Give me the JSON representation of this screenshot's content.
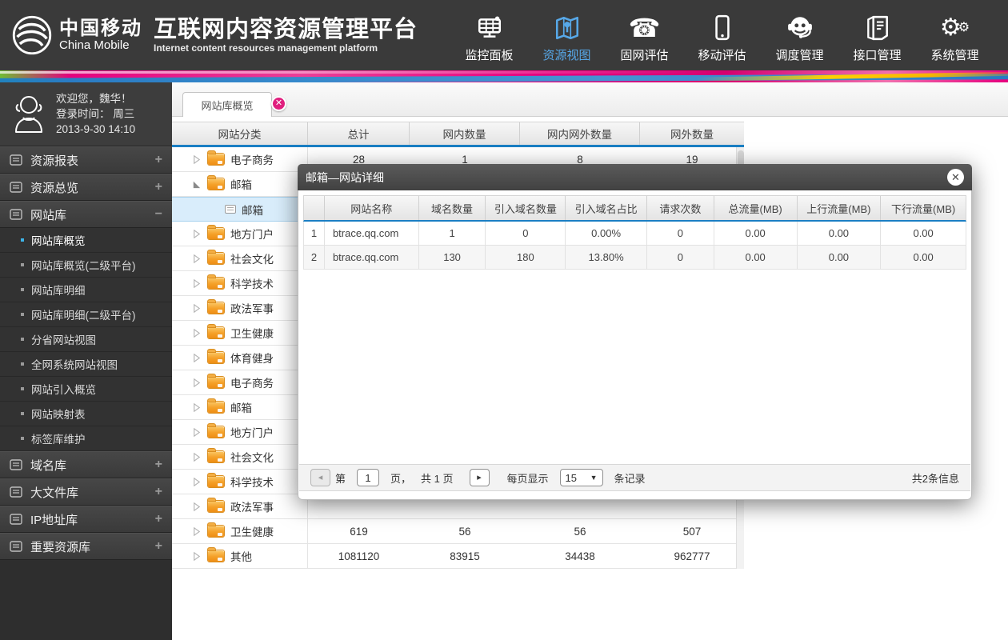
{
  "header": {
    "logo_cn": "中国移动",
    "logo_en": "China Mobile",
    "title": "互联网内容资源管理平台",
    "subtitle": "Internet content resources management platform",
    "nav": [
      {
        "label": "监控面板",
        "icon": "dashboard-icon",
        "active": false
      },
      {
        "label": "资源视图",
        "icon": "map-icon",
        "active": true
      },
      {
        "label": "固网评估",
        "icon": "telephone-icon",
        "active": false
      },
      {
        "label": "移动评估",
        "icon": "mobile-icon",
        "active": false
      },
      {
        "label": "调度管理",
        "icon": "headset-icon",
        "active": false
      },
      {
        "label": "接口管理",
        "icon": "document-icon",
        "active": false
      },
      {
        "label": "系统管理",
        "icon": "gears-icon",
        "active": false
      }
    ]
  },
  "sidebar": {
    "user": {
      "welcome": "欢迎您，魏华！",
      "login_line": "登录时间：  周三",
      "login_datetime": "2013-9-30   14:10"
    },
    "groups_top": [
      {
        "label": "资源报表",
        "expander": "+",
        "expanded": false
      },
      {
        "label": "资源总览",
        "expander": "+",
        "expanded": false
      },
      {
        "label": "网站库",
        "expander": "−",
        "expanded": true
      }
    ],
    "submenu": [
      {
        "label": "网站库概览",
        "active": true
      },
      {
        "label": "网站库概览(二级平台)",
        "active": false
      },
      {
        "label": "网站库明细",
        "active": false
      },
      {
        "label": "网站库明细(二级平台)",
        "active": false
      },
      {
        "label": "分省网站视图",
        "active": false
      },
      {
        "label": "全网系统网站视图",
        "active": false
      },
      {
        "label": "网站引入概览",
        "active": false
      },
      {
        "label": "网站映射表",
        "active": false
      },
      {
        "label": "标签库维护",
        "active": false
      }
    ],
    "groups_bottom": [
      {
        "label": "域名库",
        "expander": "+",
        "expanded": false
      },
      {
        "label": "大文件库",
        "expander": "+",
        "expanded": false
      },
      {
        "label": "IP地址库",
        "expander": "+",
        "expanded": false
      },
      {
        "label": "重要资源库",
        "expander": "+",
        "expanded": false
      }
    ]
  },
  "main": {
    "tab": {
      "label": "网站库概览",
      "close": "✕"
    },
    "table": {
      "headers": [
        "网站分类",
        "总计",
        "网内数量",
        "网内网外数量",
        "网外数量"
      ],
      "rows": [
        {
          "label": "电子商务",
          "node": "collapsed",
          "selected": false,
          "values": [
            "28",
            "1",
            "8",
            "19"
          ]
        },
        {
          "label": "邮箱",
          "node": "expanded",
          "selected": false,
          "values": [
            "",
            "",
            "",
            ""
          ]
        },
        {
          "label": "邮箱",
          "node": "leaf",
          "selected": true,
          "values": [
            "",
            "",
            "",
            ""
          ]
        },
        {
          "label": "地方门户",
          "node": "collapsed",
          "selected": false,
          "values": [
            "",
            "",
            "",
            ""
          ]
        },
        {
          "label": "社会文化",
          "node": "collapsed",
          "selected": false,
          "values": [
            "",
            "",
            "",
            ""
          ]
        },
        {
          "label": "科学技术",
          "node": "collapsed",
          "selected": false,
          "values": [
            "",
            "",
            "",
            ""
          ]
        },
        {
          "label": "政法军事",
          "node": "collapsed",
          "selected": false,
          "values": [
            "",
            "",
            "",
            ""
          ]
        },
        {
          "label": "卫生健康",
          "node": "collapsed",
          "selected": false,
          "values": [
            "",
            "",
            "",
            ""
          ]
        },
        {
          "label": "体育健身",
          "node": "collapsed",
          "selected": false,
          "values": [
            "",
            "",
            "",
            ""
          ]
        },
        {
          "label": "电子商务",
          "node": "collapsed",
          "selected": false,
          "values": [
            "",
            "",
            "",
            ""
          ]
        },
        {
          "label": "邮箱",
          "node": "collapsed",
          "selected": false,
          "values": [
            "",
            "",
            "",
            ""
          ]
        },
        {
          "label": "地方门户",
          "node": "collapsed",
          "selected": false,
          "values": [
            "",
            "",
            "",
            ""
          ]
        },
        {
          "label": "社会文化",
          "node": "collapsed",
          "selected": false,
          "values": [
            "",
            "",
            "",
            ""
          ]
        },
        {
          "label": "科学技术",
          "node": "collapsed",
          "selected": false,
          "values": [
            "",
            "",
            "",
            ""
          ]
        },
        {
          "label": "政法军事",
          "node": "collapsed",
          "selected": false,
          "values": [
            "",
            "",
            "",
            ""
          ]
        },
        {
          "label": "卫生健康",
          "node": "collapsed",
          "selected": false,
          "values": [
            "619",
            "56",
            "56",
            "507"
          ]
        },
        {
          "label": "其他",
          "node": "collapsed",
          "selected": false,
          "values": [
            "1081120",
            "83915",
            "34438",
            "962777"
          ]
        }
      ]
    }
  },
  "modal": {
    "title": "邮箱—网站详细",
    "close": "✕",
    "table": {
      "headers": [
        "",
        "网站名称",
        "域名数量",
        "引入域名数量",
        "引入域名占比",
        "请求次数",
        "总流量(MB)",
        "上行流量(MB)",
        "下行流量(MB)"
      ],
      "rows": [
        [
          "1",
          "btrace.qq.com",
          "1",
          "0",
          "0.00%",
          "0",
          "0.00",
          "0.00",
          "0.00"
        ],
        [
          "2",
          "btrace.qq.com",
          "130",
          "180",
          "13.80%",
          "0",
          "0.00",
          "0.00",
          "0.00"
        ]
      ]
    },
    "pagination": {
      "prev": "◂",
      "page_prefix": "第",
      "page_value": "1",
      "page_suffix": "页，",
      "total_pages": "共 1 页",
      "next": "▸",
      "per_page_label": "每页显示",
      "per_page_value": "15",
      "per_page_caret": "▼",
      "per_page_suffix": "条记录",
      "total_info": "共2条信息"
    }
  },
  "colors": {
    "accent_blue": "#1b7fc4",
    "active_nav": "#57a8e8",
    "brand_pink": "#e5007d",
    "header_bg": "#3a3a3a",
    "selected_row_bg": "#d9edfb",
    "folder_orange": "#f5a028"
  }
}
